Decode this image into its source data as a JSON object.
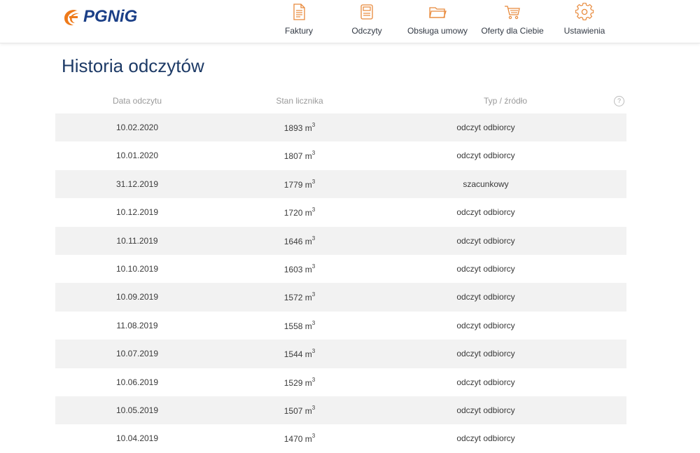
{
  "brand": {
    "name": "PGNiG",
    "colors": {
      "flame": "#ee7a1a",
      "text": "#1b3f87"
    }
  },
  "nav": [
    {
      "label": "Faktury",
      "icon": "invoice-icon"
    },
    {
      "label": "Odczyty",
      "icon": "meter-reading-icon"
    },
    {
      "label": "Obsługa umowy",
      "icon": "folder-icon"
    },
    {
      "label": "Oferty dla Ciebie",
      "icon": "cart-icon"
    },
    {
      "label": "Ustawienia",
      "icon": "gear-icon"
    }
  ],
  "page": {
    "title": "Historia odczytów"
  },
  "table": {
    "headers": {
      "date": "Data odczytu",
      "reading": "Stan licznika",
      "type": "Typ / źródło",
      "help": "?"
    },
    "unit": "m",
    "unit_exp": "3",
    "rows": [
      {
        "date": "10.02.2020",
        "reading": "1893",
        "type": "odczyt odbiorcy"
      },
      {
        "date": "10.01.2020",
        "reading": "1807",
        "type": "odczyt odbiorcy"
      },
      {
        "date": "31.12.2019",
        "reading": "1779",
        "type": "szacunkowy"
      },
      {
        "date": "10.12.2019",
        "reading": "1720",
        "type": "odczyt odbiorcy"
      },
      {
        "date": "10.11.2019",
        "reading": "1646",
        "type": "odczyt odbiorcy"
      },
      {
        "date": "10.10.2019",
        "reading": "1603",
        "type": "odczyt odbiorcy"
      },
      {
        "date": "10.09.2019",
        "reading": "1572",
        "type": "odczyt odbiorcy"
      },
      {
        "date": "11.08.2019",
        "reading": "1558",
        "type": "odczyt odbiorcy"
      },
      {
        "date": "10.07.2019",
        "reading": "1544",
        "type": "odczyt odbiorcy"
      },
      {
        "date": "10.06.2019",
        "reading": "1529",
        "type": "odczyt odbiorcy"
      },
      {
        "date": "10.05.2019",
        "reading": "1507",
        "type": "odczyt odbiorcy"
      },
      {
        "date": "10.04.2019",
        "reading": "1470",
        "type": "odczyt odbiorcy"
      }
    ]
  },
  "colors": {
    "accent": "#ee7a1a",
    "title": "#1d3a66",
    "row_stripe": "#f2f2f2"
  }
}
